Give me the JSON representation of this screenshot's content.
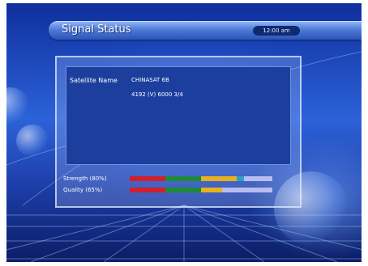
{
  "header": {
    "title": "Signal Status",
    "time": "12:00 am"
  },
  "satellite": {
    "label": "Satellite Name",
    "name": "CHINASAT 6B",
    "transponder": "4192 (V) 6000 3/4"
  },
  "meters": [
    {
      "label": "Strength (80%)",
      "value": 0.8
    },
    {
      "label": "Quality (65%)",
      "value": 0.65
    }
  ],
  "colors": {
    "bar_low": "#d31e2c",
    "bar_mid": "#1f8a3a",
    "bar_high": "#e8b21e",
    "bar_max": "#2aa2c8",
    "bar_track": "#b8bdf0"
  }
}
